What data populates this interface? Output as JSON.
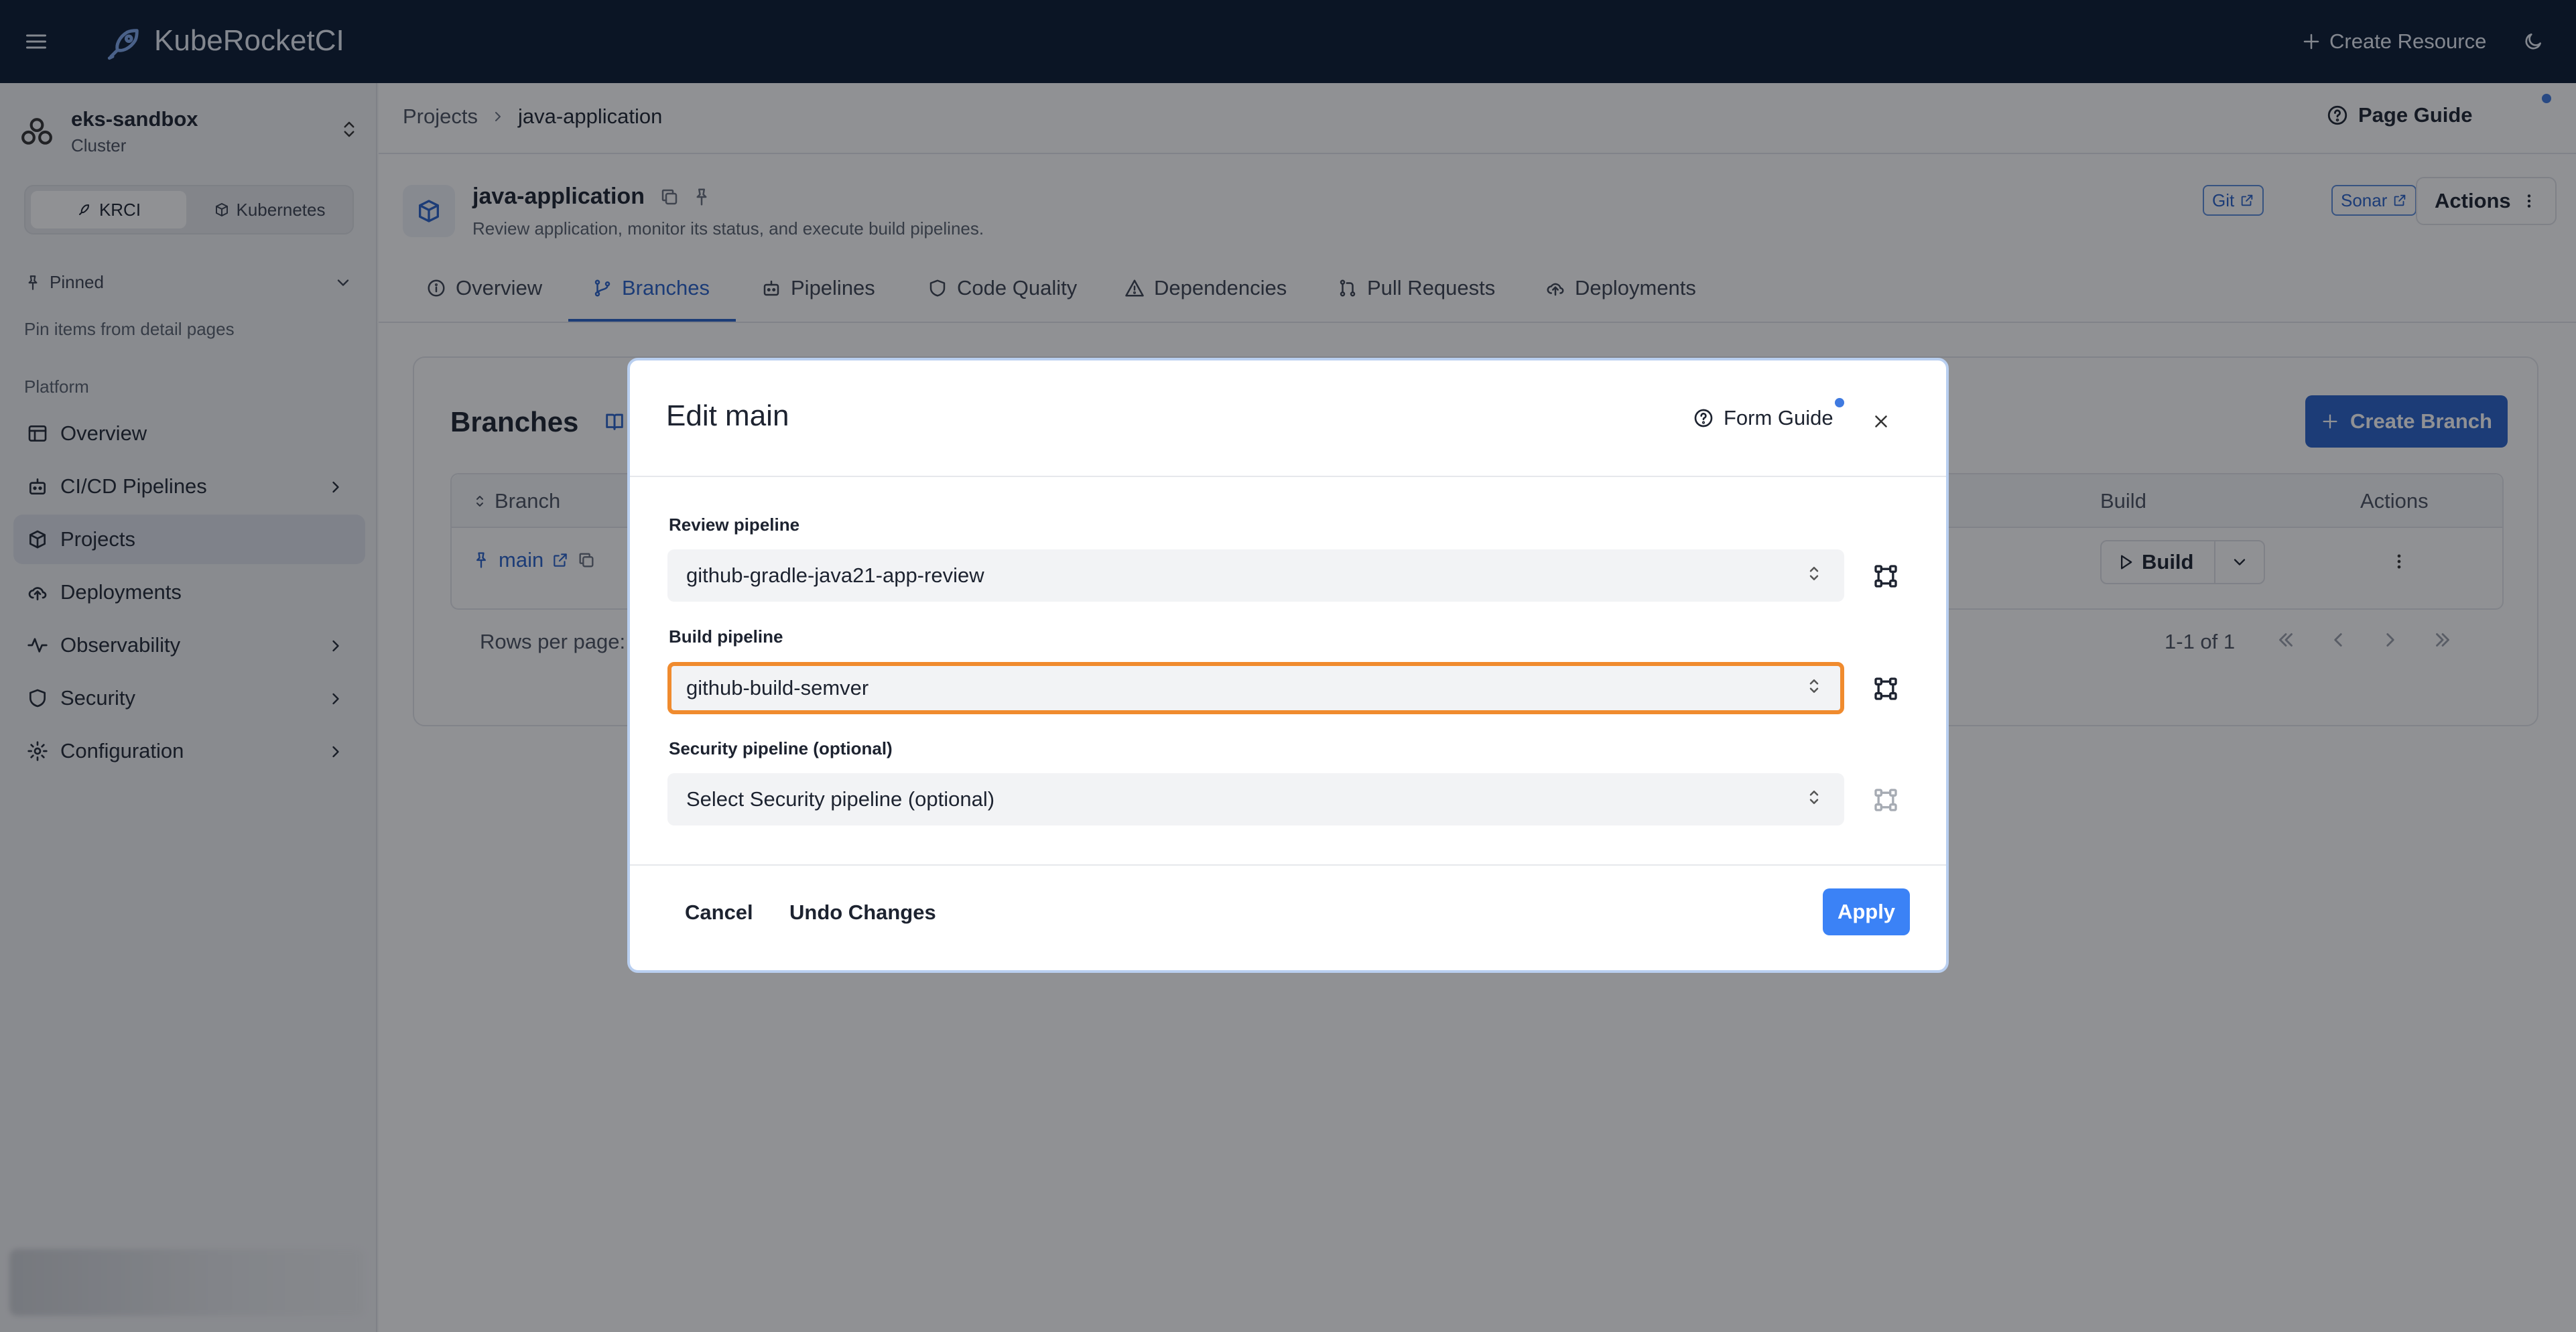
{
  "app": {
    "title": "KubeRocketCI",
    "create_resource": "Create Resource"
  },
  "sidebar": {
    "cluster_name": "eks-sandbox",
    "cluster_type": "Cluster",
    "switch": {
      "krci": "KRCI",
      "kubernetes": "Kubernetes"
    },
    "pinned_label": "Pinned",
    "pinned_hint": "Pin items from detail pages",
    "section_label": "Platform",
    "items": [
      {
        "label": "Overview"
      },
      {
        "label": "CI/CD Pipelines"
      },
      {
        "label": "Projects"
      },
      {
        "label": "Deployments"
      },
      {
        "label": "Observability"
      },
      {
        "label": "Security"
      },
      {
        "label": "Configuration"
      }
    ]
  },
  "breadcrumb": {
    "root": "Projects",
    "current": "java-application"
  },
  "page_guide": "Page Guide",
  "project": {
    "name": "java-application",
    "description": "Review application, monitor its status, and execute build pipelines.",
    "links": {
      "git": "Git",
      "sonar": "Sonar"
    },
    "actions": "Actions"
  },
  "tabs": [
    "Overview",
    "Branches",
    "Pipelines",
    "Code Quality",
    "Dependencies",
    "Pull Requests",
    "Deployments"
  ],
  "branches": {
    "title": "Branches",
    "create_button": "Create Branch",
    "columns": {
      "branch": "Branch",
      "build": "Build",
      "actions": "Actions"
    },
    "rows": [
      {
        "name": "main",
        "build_label": "Build"
      }
    ],
    "rows_per_page": "Rows per page:",
    "pagination": "1-1 of 1"
  },
  "modal": {
    "title": "Edit main",
    "form_guide": "Form Guide",
    "fields": [
      {
        "label": "Review pipeline",
        "value": "github-gradle-java21-app-review"
      },
      {
        "label": "Build pipeline",
        "value": "github-build-semver"
      },
      {
        "label": "Security pipeline (optional)",
        "placeholder": "Select Security pipeline (optional)"
      }
    ],
    "cancel": "Cancel",
    "undo": "Undo Changes",
    "apply": "Apply"
  },
  "colors": {
    "topbar": "#0a1a33",
    "accent": "#2a62c9",
    "highlight": "#f08b2e"
  }
}
